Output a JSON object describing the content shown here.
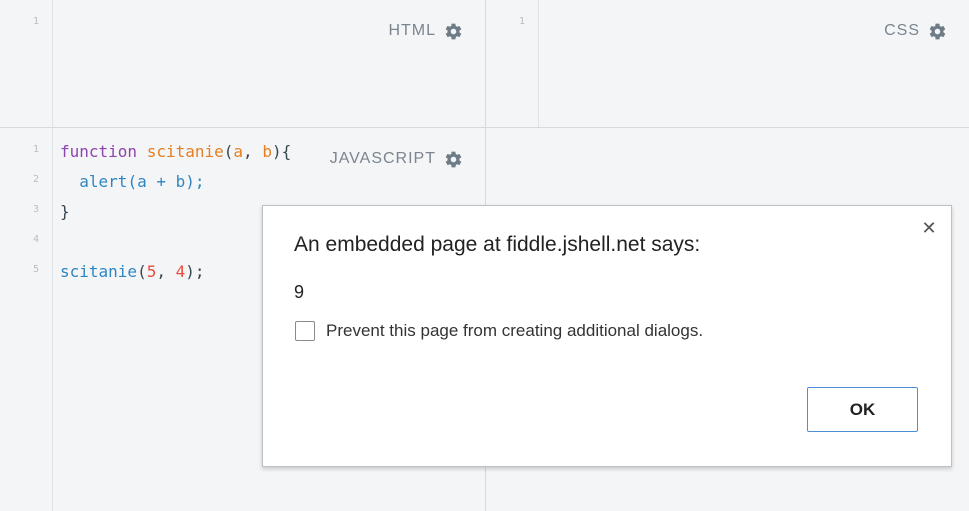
{
  "panels": {
    "html": {
      "label": "HTML",
      "line_numbers": [
        "1"
      ]
    },
    "css": {
      "label": "CSS",
      "line_numbers": [
        "1"
      ]
    },
    "javascript": {
      "label": "JAVASCRIPT",
      "line_numbers": [
        "1",
        "2",
        "3",
        "4",
        "5"
      ]
    }
  },
  "code": {
    "line1": {
      "keyword": "function",
      "name": "scitanie",
      "open": "(",
      "a": "a",
      "sep": ", ",
      "b": "b",
      "close": "){"
    },
    "line2": {
      "indent": "  ",
      "call": "alert",
      "args": "(a + b);"
    },
    "line3": {
      "text": "}"
    },
    "line5": {
      "call": "scitanie",
      "open": "(",
      "n1": "5",
      "sep": ", ",
      "n2": "4",
      "close": ");"
    }
  },
  "dialog": {
    "title": "An embedded page at fiddle.jshell.net says:",
    "message": "9",
    "checkbox_label": "Prevent this page from creating additional dialogs.",
    "checkbox_checked": false,
    "ok_label": "OK",
    "close_glyph": "✕"
  },
  "colors": {
    "keyword": "#8e44ad",
    "function_name": "#e67e22",
    "call": "#2e86c1",
    "number": "#e74c3c",
    "ok_border": "#4a90d9"
  },
  "icons": {
    "panel_settings": "gear-icon",
    "dialog_close": "close-icon"
  }
}
